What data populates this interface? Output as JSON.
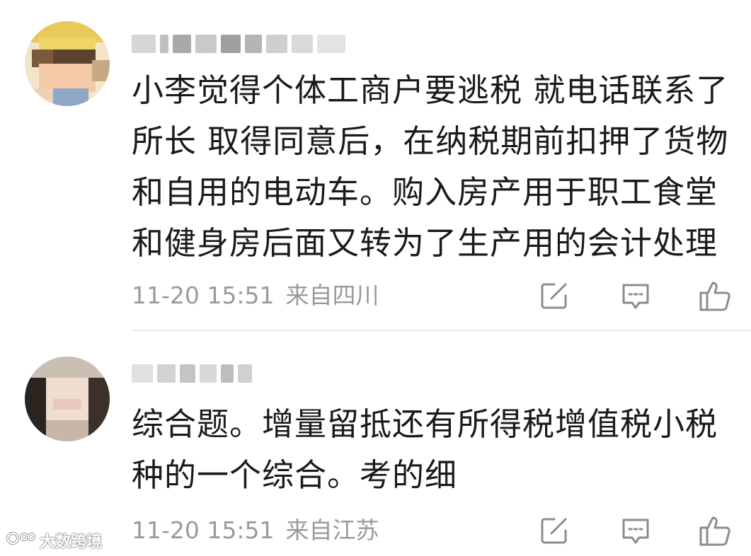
{
  "comments": [
    {
      "text": "小李觉得个体工商户要逃税 就电话联系了所长 取得同意后，在纳税期前扣押了货物和自用的电动车。购入房产用于职工食堂和健身房后面又转为了生产用的会计处理",
      "time": "11-20 15:51",
      "location": "来自四川",
      "actions": {
        "share_icon": "edit-share-icon",
        "reply_icon": "comment-icon",
        "like_icon": "thumbs-up-icon"
      }
    },
    {
      "text": "综合题。增量留抵还有所得税增值税小税种的一个综合。考的细",
      "time": "11-20 15:51",
      "location": "来自江苏",
      "actions": {
        "share_icon": "edit-share-icon",
        "reply_icon": "comment-icon",
        "like_icon": "thumbs-up-icon"
      }
    }
  ],
  "watermark": {
    "text": "大数跨境"
  },
  "colors": {
    "text": "#1a1a1a",
    "meta": "#9a9a9a",
    "icon": "#8c8c8c",
    "divider": "#ececec"
  }
}
